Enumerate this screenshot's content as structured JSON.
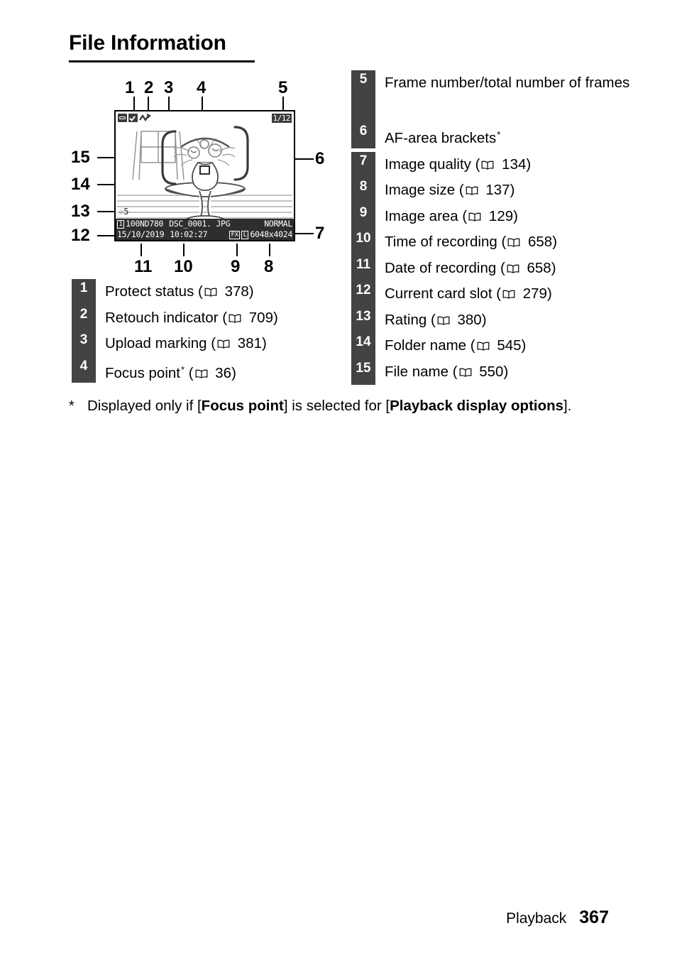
{
  "page": {
    "title": "File Information",
    "footer_section": "Playback",
    "footer_page": "367"
  },
  "figure": {
    "callouts_top": [
      "1",
      "2",
      "3",
      "4",
      "5"
    ],
    "callouts_left": [
      "15",
      "14",
      "13",
      "12"
    ],
    "callouts_right": [
      "6",
      "7"
    ],
    "callouts_bottom": [
      "11",
      "10",
      "9",
      "8"
    ],
    "monitor": {
      "icon_protect": "protect-key-icon",
      "icon_retouch": "retouch-checkmark-icon",
      "icon_upload": "upload-marking-icon",
      "frame_counter": "1/12",
      "rating_star": "☆",
      "rating_value": "5",
      "card_slot": "1",
      "folder_name": "100ND780",
      "file_name": "DSC_0001. JPG",
      "image_quality": "NORMAL",
      "date_of_recording": "15/10/2019",
      "time_of_recording": "10:02:27",
      "image_area": "FX",
      "image_size_chip": "L",
      "image_size": "6048x4024"
    }
  },
  "legend_left": [
    {
      "num": "1",
      "label": "Protect status",
      "ref": "378",
      "star": false
    },
    {
      "num": "2",
      "label": "Retouch indicator",
      "ref": "709",
      "star": false
    },
    {
      "num": "3",
      "label": "Upload marking",
      "ref": "381",
      "star": false
    },
    {
      "num": "4",
      "label": "Focus point",
      "ref": "36",
      "star": true
    }
  ],
  "legend_right": [
    {
      "num": "5",
      "label": "Frame number/total number of frames",
      "ref": "",
      "star": false
    },
    {
      "num": "6",
      "label": "AF-area brackets",
      "ref": "",
      "star": true
    },
    {
      "num": "7",
      "label": "Image quality",
      "ref": "134",
      "star": false
    },
    {
      "num": "8",
      "label": "Image size",
      "ref": "137",
      "star": false
    },
    {
      "num": "9",
      "label": "Image area",
      "ref": "129",
      "star": false
    },
    {
      "num": "10",
      "label": "Time of recording",
      "ref": "658",
      "star": false
    },
    {
      "num": "11",
      "label": "Date of recording",
      "ref": "658",
      "star": false
    },
    {
      "num": "12",
      "label": "Current card slot",
      "ref": "279",
      "star": false
    },
    {
      "num": "13",
      "label": "Rating",
      "ref": "380",
      "star": false
    },
    {
      "num": "14",
      "label": "Folder name",
      "ref": "545",
      "star": false
    },
    {
      "num": "15",
      "label": "File name",
      "ref": "550",
      "star": false
    }
  ],
  "footnote": {
    "marker": "*",
    "part1": "Displayed only if [",
    "bold1": "Focus point",
    "part2": "] is selected for [",
    "bold2": "Playback display options",
    "part3": "]."
  },
  "colors": {
    "badge_bg": "#434343",
    "monitor_bar_bg": "#2e2e2e",
    "text": "#000000"
  }
}
